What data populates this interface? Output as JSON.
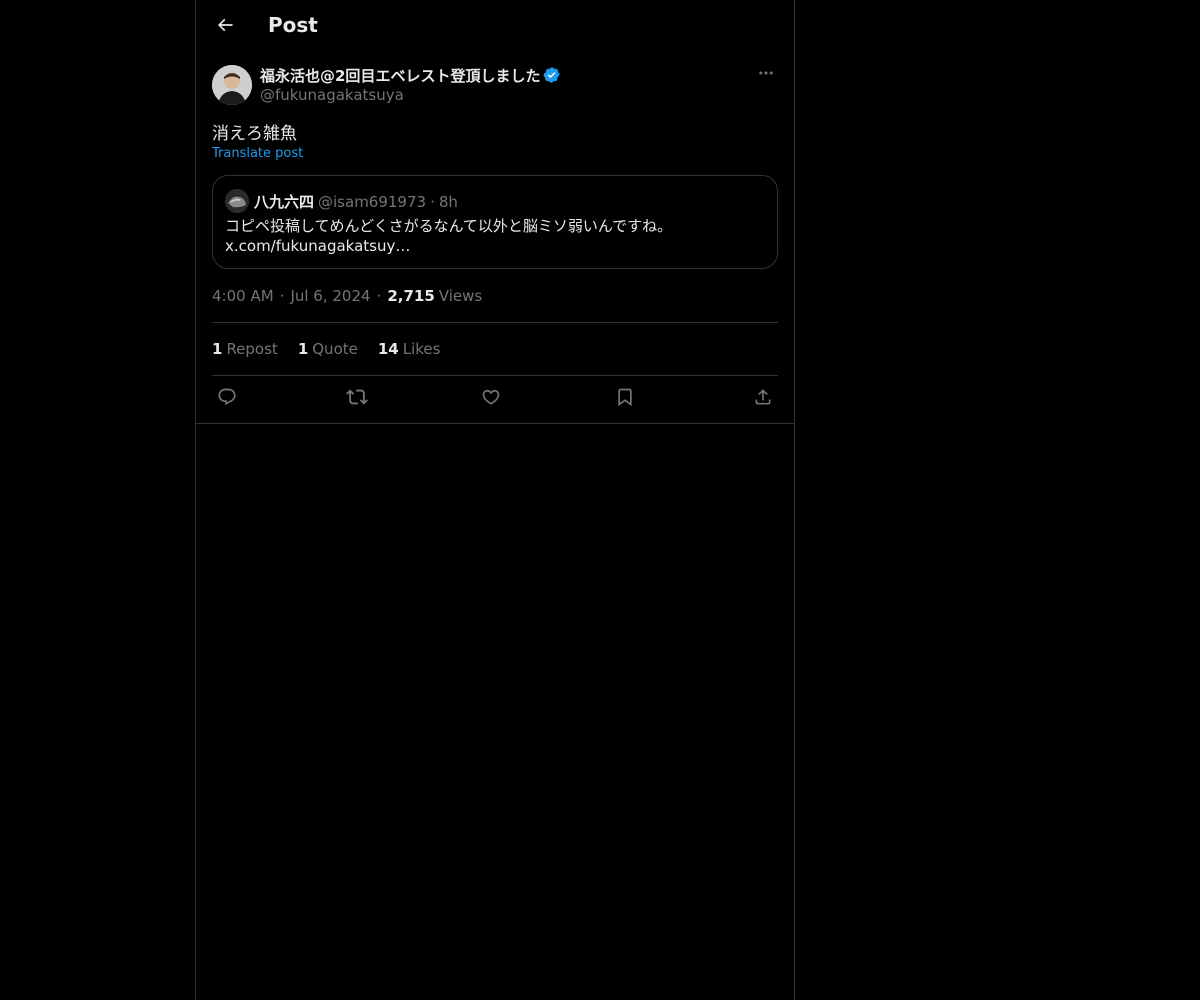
{
  "header": {
    "title": "Post"
  },
  "post": {
    "author": {
      "display_name": "福永活也@2回目エベレスト登頂しました",
      "handle": "@fukunagakatsuya",
      "verified": true
    },
    "text": "消えろ雑魚",
    "translate_label": "Translate post",
    "quoted": {
      "display_name": "八九六四",
      "handle": "@isam691973",
      "separator": "·",
      "time": "8h",
      "text_line1": "コピペ投稿してめんどくさがるなんて以外と脳ミソ弱いんですね。",
      "text_line2": "x.com/fukunagakatsuy…"
    },
    "meta": {
      "time": "4:00 AM",
      "sep": "·",
      "date": "Jul 6, 2024",
      "views_count": "2,715",
      "views_label": "Views"
    },
    "stats": {
      "reposts_count": "1",
      "reposts_label": "Repost",
      "quotes_count": "1",
      "quotes_label": "Quote",
      "likes_count": "14",
      "likes_label": "Likes"
    }
  },
  "icons": {
    "back": "arrow-left-icon",
    "verified": "verified-badge-icon",
    "more": "more-horizontal-icon",
    "reply": "reply-icon",
    "repost": "repost-icon",
    "like": "heart-icon",
    "bookmark": "bookmark-icon",
    "share": "share-icon"
  },
  "colors": {
    "background": "#000000",
    "text_primary": "#e7e9ea",
    "text_secondary": "#71767b",
    "accent": "#1d9bf0",
    "border": "#2f3336"
  }
}
